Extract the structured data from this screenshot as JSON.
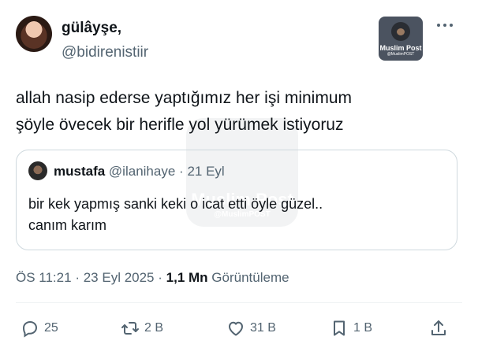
{
  "tweet": {
    "display_name": "gülâyşe,",
    "handle": "@bidirenistiir",
    "text_line1": "allah nasip ederse yaptığımız her işi minimum",
    "text_line2": "şöyle övecek bir herifle yol yürümek istiyoruz"
  },
  "badge": {
    "title": "Muslim Post",
    "subtitle": "@MuslimPOST"
  },
  "watermark": {
    "title": "Muslim Post",
    "subtitle": "@MuslimPOST"
  },
  "quoted": {
    "name": "mustafa",
    "handle": "@ilanihaye",
    "separator": "·",
    "date": "21 Eyl",
    "text_line1": "bir kek yapmış sanki keki o icat etti öyle güzel..",
    "text_line2": "canım karım"
  },
  "meta": {
    "time": "ÖS 11:21",
    "sep1": "·",
    "date": "23 Eyl 2025",
    "sep2": "·",
    "views_count": "1,1 Mn",
    "views_label": "Görüntüleme"
  },
  "actions": {
    "replies": "25",
    "reposts": "2 B",
    "likes": "31 B",
    "bookmarks": "1 B"
  },
  "icons": [
    "more-icon",
    "reply-icon",
    "repost-icon",
    "like-icon",
    "bookmark-icon",
    "share-icon"
  ]
}
